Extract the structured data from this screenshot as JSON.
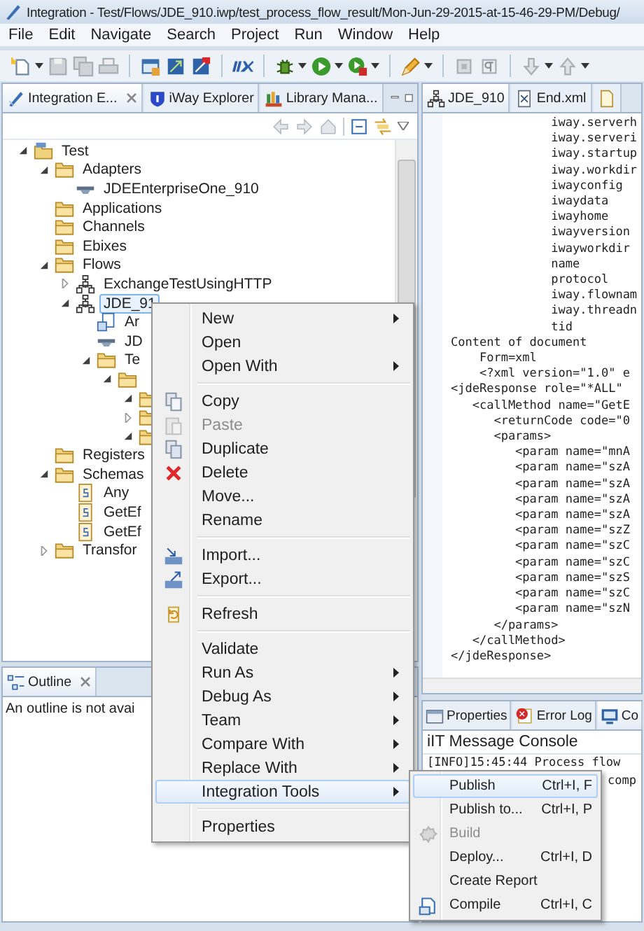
{
  "window": {
    "title": "Integration - Test/Flows/JDE_910.iwp/test_process_flow_result/Mon-Jun-29-2015-at-15-46-29-PM/Debug/"
  },
  "menu_bar": [
    "File",
    "Edit",
    "Navigate",
    "Search",
    "Project",
    "Run",
    "Window",
    "Help"
  ],
  "toolbar": [
    {
      "kind": "new",
      "caret": true
    },
    {
      "kind": "save",
      "caret": false
    },
    {
      "kind": "save-all",
      "caret": false
    },
    {
      "kind": "print",
      "caret": false
    },
    {
      "kind": "separator"
    },
    {
      "kind": "window",
      "caret": false
    },
    {
      "kind": "deploy",
      "caret": false
    },
    {
      "kind": "undeploy",
      "caret": false
    },
    {
      "kind": "separator"
    },
    {
      "kind": "logo",
      "caret": false
    },
    {
      "kind": "separator"
    },
    {
      "kind": "bug",
      "caret": true
    },
    {
      "kind": "run",
      "caret": true
    },
    {
      "kind": "run-tool",
      "caret": true
    },
    {
      "kind": "separator"
    },
    {
      "kind": "pencil",
      "caret": true
    },
    {
      "kind": "separator"
    },
    {
      "kind": "box",
      "caret": false
    },
    {
      "kind": "paragraph",
      "caret": false
    },
    {
      "kind": "separator"
    },
    {
      "kind": "next",
      "caret": true
    },
    {
      "kind": "prev",
      "caret": true
    }
  ],
  "explorer": {
    "tabs": [
      {
        "label": "Integration E...",
        "kind": "explorer",
        "selected": true
      },
      {
        "label": "iWay Explorer",
        "kind": "iway",
        "selected": false
      },
      {
        "label": "Library Mana...",
        "kind": "library",
        "selected": false
      }
    ],
    "tree": [
      {
        "label": "Test",
        "kind": "project",
        "expanded": true,
        "selected": false,
        "children": [
          {
            "label": "Adapters",
            "kind": "folder",
            "expanded": true,
            "selected": false,
            "children": [
              {
                "label": "JDEEnterpriseOne_910",
                "kind": "adapter",
                "selected": false
              }
            ]
          },
          {
            "label": "Applications",
            "kind": "folder",
            "selected": false
          },
          {
            "label": "Channels",
            "kind": "folder",
            "selected": false
          },
          {
            "label": "Ebixes",
            "kind": "folder",
            "selected": false
          },
          {
            "label": "Flows",
            "kind": "folder",
            "expanded": true,
            "selected": false,
            "children": [
              {
                "label": "ExchangeTestUsingHTTP",
                "kind": "flow",
                "expanded": false,
                "selected": false
              },
              {
                "label": "JDE_91",
                "kind": "flow",
                "expanded": true,
                "selected": true,
                "children": [
                  {
                    "label": "Ar",
                    "kind": "script",
                    "selected": false
                  },
                  {
                    "label": "JD",
                    "kind": "adapter",
                    "selected": false
                  },
                  {
                    "label": "Te",
                    "kind": "folder",
                    "expanded": true,
                    "selected": false,
                    "children": [
                      {
                        "kind": "folder",
                        "expanded": true,
                        "children": [
                          {
                            "kind": "folder",
                            "expanded": true
                          },
                          {
                            "kind": "folder",
                            "expanded": false
                          },
                          {
                            "kind": "folder",
                            "expanded": true
                          }
                        ]
                      }
                    ]
                  }
                ]
              }
            ]
          },
          {
            "label": "Registers",
            "kind": "folder",
            "selected": false
          },
          {
            "label": "Schemas",
            "kind": "folder",
            "expanded": true,
            "selected": false,
            "children": [
              {
                "label": "Any",
                "kind": "schema",
                "selected": false
              },
              {
                "label": "GetEf",
                "kind": "schema",
                "selected": false
              },
              {
                "label": "GetEf",
                "kind": "schema",
                "selected": false
              }
            ]
          },
          {
            "label": "Transfor",
            "kind": "folder",
            "expanded": false,
            "selected": false
          }
        ]
      }
    ]
  },
  "outline": {
    "tab": "Outline",
    "message": "An outline is not avai"
  },
  "editor": {
    "tabs": [
      {
        "label": "JDE_910",
        "kind": "flow",
        "selected": true
      },
      {
        "label": "End.xml",
        "kind": "xml",
        "selected": false
      },
      {
        "kind": "file",
        "selected": false
      }
    ],
    "lines": [
      "              iway.serverh",
      "              iway.serveri",
      "              iway.startup",
      "              iway.workdir",
      "              iwayconfig",
      "              iwaydata",
      "              iwayhome",
      "              iwayversion",
      "              iwayworkdir",
      "              name",
      "              protocol",
      "              iway.flownam",
      "              iway.threadn",
      "              tid",
      "Content of document",
      "    Form=xml",
      "    <?xml version=\"1.0\" e",
      "<jdeResponse role=\"*ALL\"",
      "   <callMethod name=\"GetE",
      "      <returnCode code=\"0",
      "      <params>",
      "         <param name=\"mnA",
      "         <param name=\"szA",
      "         <param name=\"szA",
      "         <param name=\"szA",
      "         <param name=\"szA",
      "         <param name=\"szZ",
      "         <param name=\"szC",
      "         <param name=\"szC",
      "         <param name=\"szS",
      "         <param name=\"szC",
      "         <param name=\"szN",
      "      </params>",
      "   </callMethod>",
      "</jdeResponse>"
    ]
  },
  "console": {
    "tabs": [
      {
        "label": "Properties",
        "kind": "properties",
        "selected": false
      },
      {
        "label": "Error Log",
        "kind": "error-log",
        "selected": false
      },
      {
        "label": "Co",
        "kind": "console",
        "selected": true
      }
    ],
    "title": "iIT Message Console",
    "lines": [
      {
        "kind": "message",
        "text": "[INFO]15:45:44 Process flow"
      },
      {
        "kind": "continuation",
        "text": "comp"
      }
    ]
  },
  "context_menu": [
    {
      "kind": "item",
      "label": "New",
      "submenu": true,
      "disabled": false,
      "selected": false
    },
    {
      "kind": "item",
      "label": "Open",
      "submenu": false,
      "disabled": false,
      "selected": false
    },
    {
      "kind": "item",
      "label": "Open With",
      "submenu": true,
      "disabled": false,
      "selected": false
    },
    {
      "kind": "separator"
    },
    {
      "kind": "copy",
      "label": "Copy",
      "submenu": false,
      "disabled": false,
      "selected": false
    },
    {
      "kind": "paste",
      "label": "Paste",
      "submenu": false,
      "disabled": true,
      "selected": false
    },
    {
      "kind": "duplicate",
      "label": "Duplicate",
      "submenu": false,
      "disabled": false,
      "selected": false
    },
    {
      "kind": "delete",
      "label": "Delete",
      "submenu": false,
      "disabled": false,
      "selected": false
    },
    {
      "kind": "item",
      "label": "Move...",
      "submenu": false,
      "disabled": false,
      "selected": false
    },
    {
      "kind": "item",
      "label": "Rename",
      "submenu": false,
      "disabled": false,
      "selected": false
    },
    {
      "kind": "separator"
    },
    {
      "kind": "import",
      "label": "Import...",
      "submenu": false,
      "disabled": false,
      "selected": false
    },
    {
      "kind": "export",
      "label": "Export...",
      "submenu": false,
      "disabled": false,
      "selected": false
    },
    {
      "kind": "separator"
    },
    {
      "kind": "refresh",
      "label": "Refresh",
      "submenu": false,
      "disabled": false,
      "selected": false
    },
    {
      "kind": "separator"
    },
    {
      "kind": "item",
      "label": "Validate",
      "submenu": false,
      "disabled": false,
      "selected": false
    },
    {
      "kind": "item",
      "label": "Run As",
      "submenu": true,
      "disabled": false,
      "selected": false
    },
    {
      "kind": "item",
      "label": "Debug As",
      "submenu": true,
      "disabled": false,
      "selected": false
    },
    {
      "kind": "item",
      "label": "Team",
      "submenu": true,
      "disabled": false,
      "selected": false
    },
    {
      "kind": "item",
      "label": "Compare With",
      "submenu": true,
      "disabled": false,
      "selected": false
    },
    {
      "kind": "item",
      "label": "Replace With",
      "submenu": true,
      "disabled": false,
      "selected": false
    },
    {
      "kind": "item",
      "label": "Integration Tools",
      "submenu": true,
      "disabled": false,
      "selected": true
    },
    {
      "kind": "separator"
    },
    {
      "kind": "item",
      "label": "Properties",
      "submenu": false,
      "disabled": false,
      "selected": false
    }
  ],
  "submenu": [
    {
      "kind": "item",
      "label": "Publish",
      "shortcut": "Ctrl+I, F",
      "disabled": false,
      "selected": true
    },
    {
      "kind": "item",
      "label": "Publish to...",
      "shortcut": "Ctrl+I, P",
      "disabled": false,
      "selected": false
    },
    {
      "kind": "build",
      "label": "Build",
      "disabled": true,
      "selected": false
    },
    {
      "kind": "item",
      "label": "Deploy...",
      "shortcut": "Ctrl+I, D",
      "disabled": false,
      "selected": false
    },
    {
      "kind": "item",
      "label": "Create Report",
      "disabled": false,
      "selected": false
    },
    {
      "kind": "compile",
      "label": "Compile",
      "shortcut": "Ctrl+I, C",
      "disabled": false,
      "selected": false
    }
  ]
}
